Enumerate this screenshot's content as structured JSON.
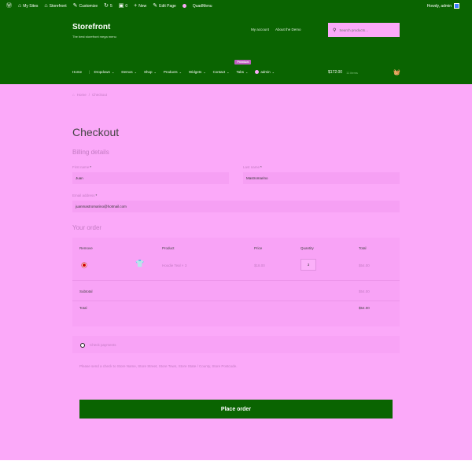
{
  "admin_bar": {
    "items": [
      {
        "icon": "wordpress-icon",
        "label": ""
      },
      {
        "icon": "home-icon",
        "label": "My Sites"
      },
      {
        "icon": "home-icon",
        "label": "Storefront"
      },
      {
        "icon": "brush-icon",
        "label": "Customize"
      },
      {
        "icon": "refresh-icon",
        "label": "5"
      },
      {
        "icon": "comment-icon",
        "label": "0"
      },
      {
        "icon": "plus-icon",
        "label": "New"
      },
      {
        "icon": "pencil-icon",
        "label": "Edit Page"
      },
      {
        "icon": "circle-icon",
        "label": ""
      },
      {
        "icon": "",
        "label": "QuadMenu"
      }
    ],
    "howdy": "Howdy, admin"
  },
  "header": {
    "site_title": "Storefront",
    "site_desc": "The best storefront mega menu",
    "secondary_nav": [
      "My account",
      "About the Demo"
    ],
    "search_placeholder": "Search products…",
    "nav": [
      {
        "label": "Home",
        "chevron": false
      },
      {
        "label": "Dropdown",
        "chevron": true
      },
      {
        "label": "Demos",
        "chevron": true
      },
      {
        "label": "Shop",
        "chevron": true
      },
      {
        "label": "Products",
        "chevron": true
      },
      {
        "label": "Widgets",
        "chevron": true
      },
      {
        "label": "Contact",
        "chevron": true
      },
      {
        "label": "Tabs",
        "chevron": true,
        "badge": "Premium"
      },
      {
        "label": "admin",
        "chevron": true
      }
    ],
    "cart_total": "$172.00",
    "cart_count": "11 items"
  },
  "breadcrumb": {
    "home": "Home",
    "separator": "/",
    "current": "Checkout"
  },
  "page_title": "Checkout",
  "billing": {
    "heading": "Billing details",
    "first_name_label": "First name",
    "first_name_value": "Juan",
    "last_name_label": "Last name",
    "last_name_value": "Mastromarino",
    "email_label": "Email address",
    "email_value": "juanmastromarino@hotmail.com",
    "required_mark": "*"
  },
  "order": {
    "heading": "Your order",
    "columns": [
      "Remove",
      "Product",
      "Price",
      "Quantity",
      "Total"
    ],
    "item": {
      "product": "Hoodie Teal × 3",
      "price": "$18.00",
      "quantity": "3",
      "total": "$54.00"
    },
    "subtotal_label": "Subtotal",
    "subtotal_value": "$54.00",
    "total_label": "Total",
    "total_value": "$54.00"
  },
  "payment": {
    "method": "Check payments",
    "note": "Please send a check to Store Name, Store Street, Store Town, Store State / County, Store Postcode."
  },
  "place_order_label": "Place order",
  "colors": {
    "header_green": "#0a6401",
    "page_pink": "#fba9f9",
    "remove_red": "#d00000"
  }
}
